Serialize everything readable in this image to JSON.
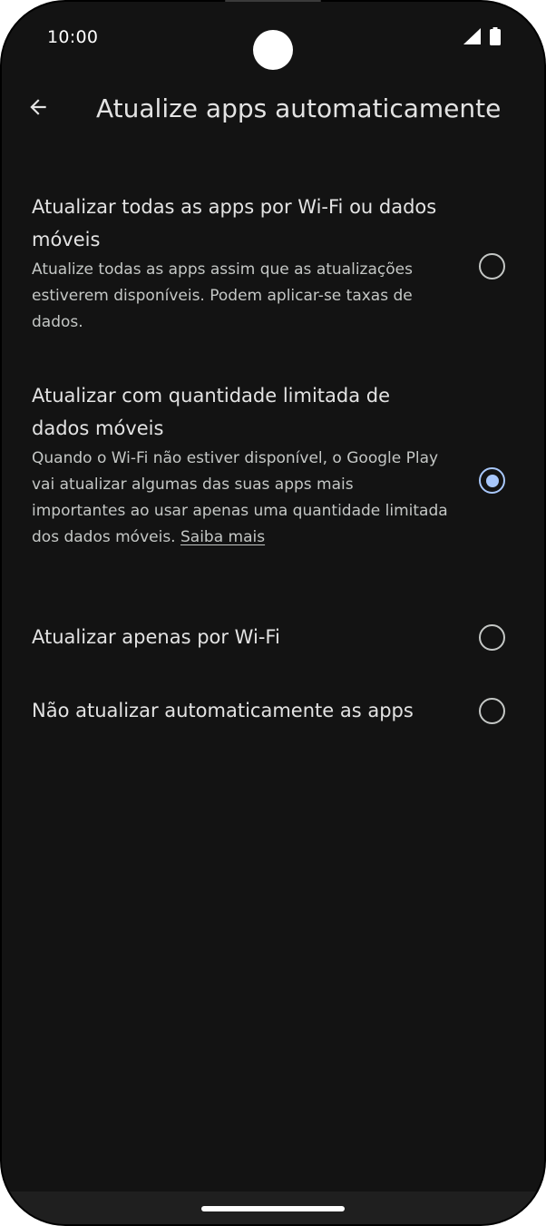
{
  "status_bar": {
    "time": "10:00",
    "icons": [
      "signal-icon",
      "battery-icon"
    ]
  },
  "app_bar": {
    "back_icon": "arrow-back-icon",
    "title": "Atualize apps automaticamente"
  },
  "options": [
    {
      "title": "Atualizar todas as apps por Wi-Fi ou dados móveis",
      "description": "Atualize todas as apps assim que as atualizações estiverem disponíveis. Podem aplicar-se taxas de dados.",
      "selected": false
    },
    {
      "title": "Atualizar com quantidade limitada de dados móveis",
      "description": "Quando o Wi-Fi não estiver disponível, o Google Play vai atualizar algumas das suas apps mais importantes ao usar apenas uma quantidade limitada dos dados móveis.",
      "link_label": "Saiba mais",
      "selected": true
    },
    {
      "title": "Atualizar apenas por Wi-Fi",
      "selected": false
    },
    {
      "title": "Não atualizar automaticamente as apps",
      "selected": false
    }
  ],
  "colors": {
    "background": "#131313",
    "text_primary": "#e3e3e3",
    "text_secondary": "#c4c7c5",
    "accent": "#a8c7fa"
  }
}
